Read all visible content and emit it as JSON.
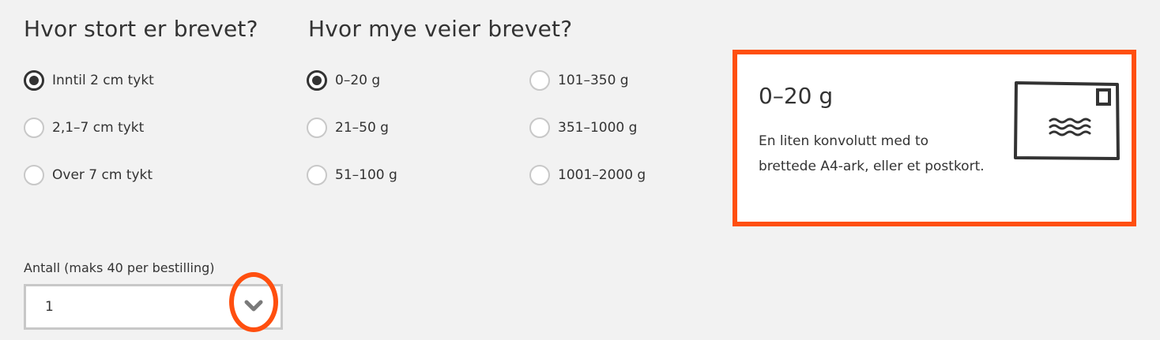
{
  "size_section": {
    "heading": "Hvor stort er brevet?",
    "options": [
      {
        "label": "Inntil 2 cm tykt",
        "selected": true
      },
      {
        "label": "2,1–7 cm tykt",
        "selected": false
      },
      {
        "label": "Over 7 cm tykt",
        "selected": false
      }
    ]
  },
  "weight_section": {
    "heading": "Hvor mye veier brevet?",
    "options": [
      {
        "label": "0–20 g",
        "selected": true
      },
      {
        "label": "21–50 g",
        "selected": false
      },
      {
        "label": "51–100 g",
        "selected": false
      },
      {
        "label": "101–350 g",
        "selected": false
      },
      {
        "label": "351–1000 g",
        "selected": false
      },
      {
        "label": "1001–2000 g",
        "selected": false
      }
    ]
  },
  "info_card": {
    "title": "0–20 g",
    "description": "En liten konvolutt med to brettede A4-ark, eller et postkort.",
    "icon": "envelope-icon",
    "border_color": "#ff4f0f"
  },
  "quantity": {
    "label": "Antall (maks 40 per bestilling)",
    "value": "1",
    "dropdown_icon": "chevron-down-icon"
  },
  "colors": {
    "accent": "#ff4f0f",
    "text": "#333333",
    "background": "#f2f2f2",
    "radio_border": "#c8c8c8"
  }
}
